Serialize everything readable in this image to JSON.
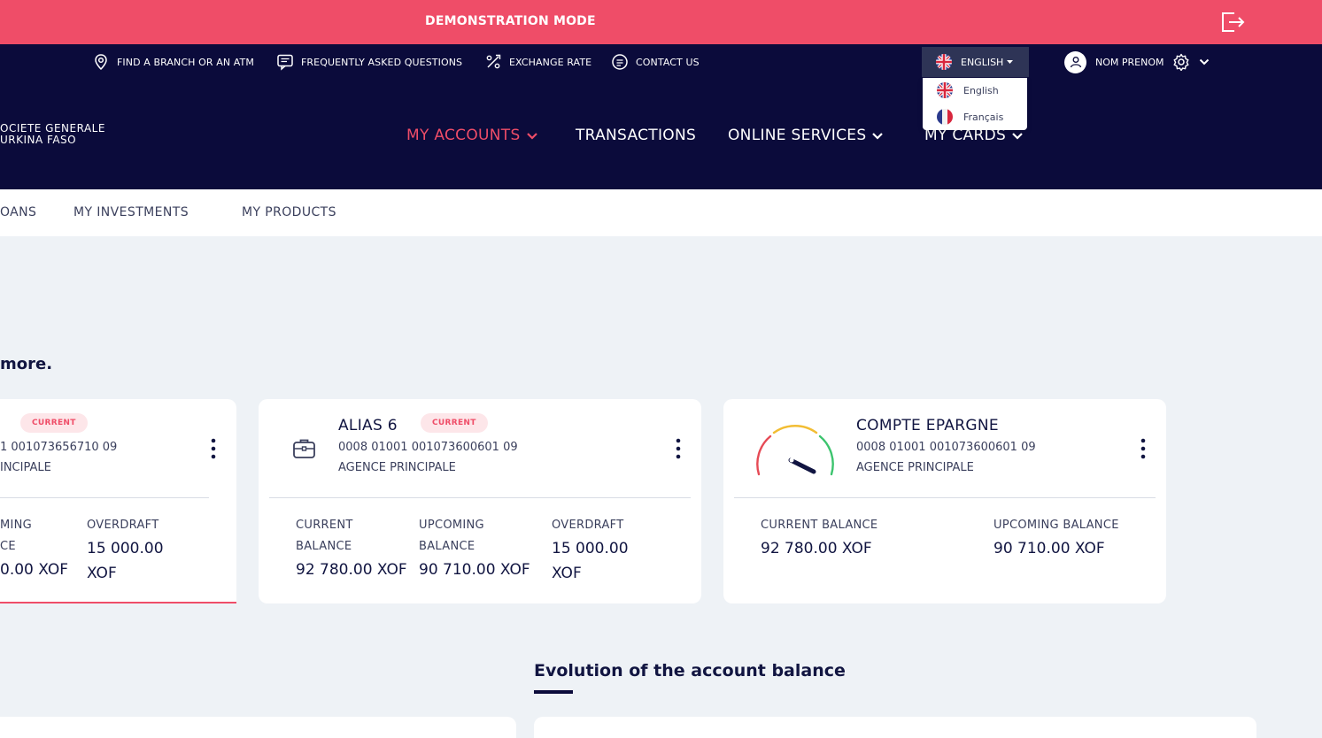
{
  "banner": {
    "demo_text": "DEMONSTRATION MODE"
  },
  "util": {
    "branch": "FIND A BRANCH OR AN ATM",
    "faq": "FREQUENTLY ASKED QUESTIONS",
    "exchange": "EXCHANGE RATE",
    "contact": "CONTACT US",
    "language": "ENGLISH",
    "user": "NOM PRENOM"
  },
  "lang_menu": {
    "items": [
      "English",
      "Français"
    ]
  },
  "logo": {
    "line1": "OCIETE GENERALE",
    "line2": "URKINA FASO"
  },
  "nav": [
    "MY ACCOUNTS",
    "TRANSACTIONS",
    "ONLINE SERVICES",
    "MY CARDS"
  ],
  "subnav": [
    "OANS",
    "MY INVESTMENTS",
    "MY PRODUCTS"
  ],
  "intro_text": "more.",
  "cards": [
    {
      "badge": "CURRENT",
      "number": "1 001073656710 09",
      "branch": "INCIPALE",
      "labels": [
        "MING",
        "CE",
        "OVERDRAFT"
      ],
      "values": [
        "0.00 XOF",
        "15 000.00",
        "XOF"
      ]
    },
    {
      "name": "ALIAS 6",
      "badge": "CURRENT",
      "number": "0008 01001 001073600601 09",
      "branch": "AGENCE PRINCIPALE",
      "labels": [
        "CURRENT",
        "BALANCE",
        "UPCOMING",
        "BALANCE",
        "OVERDRAFT"
      ],
      "values": [
        "92 780.00 XOF",
        "90 710.00 XOF",
        "15 000.00",
        "XOF"
      ]
    },
    {
      "name": "COMPTE EPARGNE",
      "number": "0008 01001 001073600601 09",
      "branch": "AGENCE PRINCIPALE",
      "labels": [
        "CURRENT BALANCE",
        "UPCOMING BALANCE"
      ],
      "values": [
        "92 780.00 XOF",
        "90 710.00 XOF"
      ]
    }
  ],
  "section_title": "Evolution of the account balance",
  "colors": {
    "accent": "#ef4d68",
    "navy": "#0b0b3b",
    "background": "#eef2f6"
  }
}
